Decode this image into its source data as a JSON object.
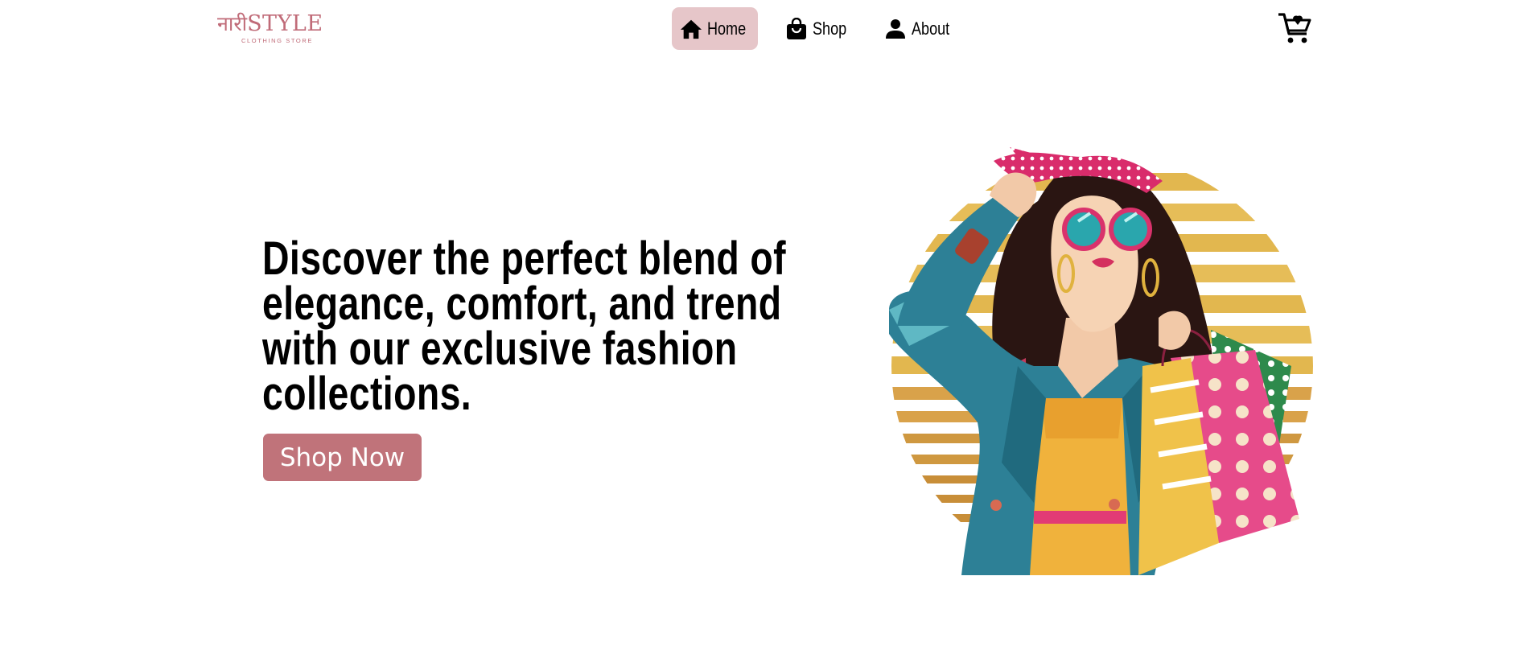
{
  "brand": {
    "logo_devanagari": "नारी",
    "logo_latin": "STYLE",
    "logo_tagline": "CLOTHING STORE",
    "color": "#c06b78"
  },
  "nav": {
    "items": [
      {
        "label": "Home",
        "icon": "home-icon",
        "active": true
      },
      {
        "label": "Shop",
        "icon": "shopping-bag-icon",
        "active": false
      },
      {
        "label": "About",
        "icon": "person-icon",
        "active": false
      }
    ],
    "active_bg": "#e6c6c9"
  },
  "cart": {
    "icon": "cart-icon"
  },
  "hero": {
    "headline_lines": [
      "Discover the perfect blend of",
      "elegance, comfort, and trend",
      "with our exclusive fashion",
      "collections."
    ],
    "cta_label": "Shop Now",
    "cta_color": "#c0737a",
    "image": "fashion-woman-shopping-illustration"
  }
}
